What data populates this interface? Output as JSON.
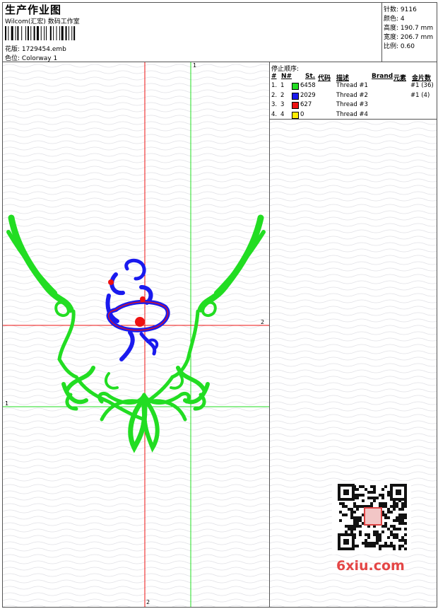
{
  "header": {
    "title": "生产作业图",
    "company": "Wilcom(汇宏) 数码工作室",
    "design_file_label": "花版:",
    "design_file": "1729454.emb",
    "colorway_label": "色位:",
    "colorway": "Colorway 1"
  },
  "stats": [
    {
      "label": "针数:",
      "value": "9116"
    },
    {
      "label": "颜色:",
      "value": "4"
    },
    {
      "label": "高度:",
      "value": "190.7 mm"
    },
    {
      "label": "宽度:",
      "value": "206.7 mm"
    },
    {
      "label": "比例:",
      "value": "0.60"
    }
  ],
  "stop_sequence": {
    "heading": "停止顺序:",
    "columns": [
      "#",
      "N#",
      "St.",
      "代码",
      "描述",
      "Brand",
      "元素",
      "金片数"
    ],
    "rows": [
      {
        "num": "1.",
        "needle": "1",
        "color": "#22dd22",
        "stitches": "6458",
        "code": "",
        "description": "Thread #1",
        "brand": "",
        "element": "",
        "sequins": "#1 (36)"
      },
      {
        "num": "2.",
        "needle": "2",
        "color": "#1a1aee",
        "stitches": "2029",
        "code": "",
        "description": "Thread #2",
        "brand": "",
        "element": "",
        "sequins": "#1 (4)"
      },
      {
        "num": "3.",
        "needle": "3",
        "color": "#ee1111",
        "stitches": "627",
        "code": "",
        "description": "Thread #3",
        "brand": "",
        "element": "",
        "sequins": ""
      },
      {
        "num": "4.",
        "needle": "4",
        "color": "#ffee00",
        "stitches": "0",
        "code": "",
        "description": "Thread #4",
        "brand": "",
        "element": "",
        "sequins": ""
      }
    ]
  },
  "canvas": {
    "marker_1": "1",
    "marker_2": "2",
    "guide_green": "#22dd22",
    "guide_red": "#ee1111"
  },
  "watermark": "6xiu.com"
}
